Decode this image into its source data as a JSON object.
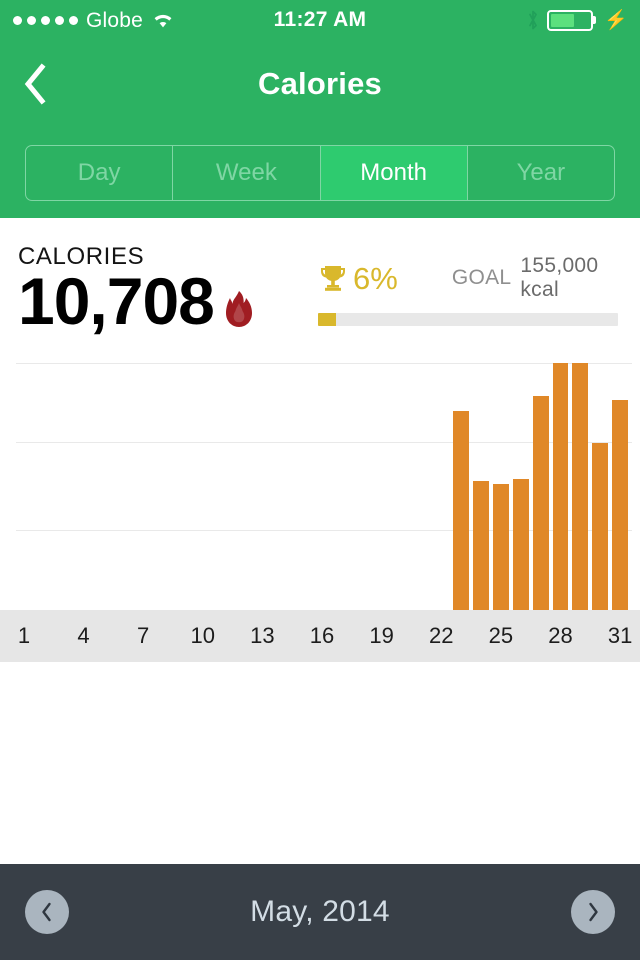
{
  "statusbar": {
    "carrier": "Globe",
    "signal_dots": 5,
    "wifi_icon": "wifi-icon",
    "time": "11:27 AM",
    "bluetooth_icon": "bluetooth-icon",
    "battery_icon": "battery-icon",
    "battery_percent": 60,
    "charging_icon": "lightning-bolt-icon"
  },
  "navbar": {
    "back_icon": "chevron-left-icon",
    "title": "Calories"
  },
  "segmented": {
    "selected": "Month",
    "options": [
      {
        "label": "Day"
      },
      {
        "label": "Week"
      },
      {
        "label": "Month"
      },
      {
        "label": "Year"
      }
    ]
  },
  "stats": {
    "label": "CALORIES",
    "value": "10,708",
    "flame_icon": "flame-icon",
    "trophy_icon": "trophy-icon",
    "percent": "6%",
    "goal_label": "GOAL",
    "goal_value": "155,000 kcal",
    "progress_percent": 6,
    "accent_gold": "#d9b82c",
    "accent_green": "#2cb262",
    "bar_orange": "#e08828"
  },
  "footer": {
    "prev_icon": "chevron-left-icon",
    "next_icon": "chevron-right-icon",
    "title": "May, 2014"
  },
  "chart_data": {
    "type": "bar",
    "title": "",
    "xlabel": "",
    "ylabel": "",
    "grid": true,
    "ticks": [
      "1",
      "4",
      "7",
      "10",
      "13",
      "16",
      "19",
      "22",
      "25",
      "28",
      "31"
    ],
    "x_range": [
      1,
      31
    ],
    "categories": [
      23,
      24,
      25,
      26,
      27,
      28,
      29,
      30,
      31
    ],
    "values": [
      1200,
      780,
      760,
      790,
      1290,
      1490,
      1490,
      1010,
      1270
    ],
    "ylim": [
      0,
      1600
    ],
    "gridline_values": [
      1450,
      1000,
      500
    ],
    "bar_color": "#e08828"
  }
}
